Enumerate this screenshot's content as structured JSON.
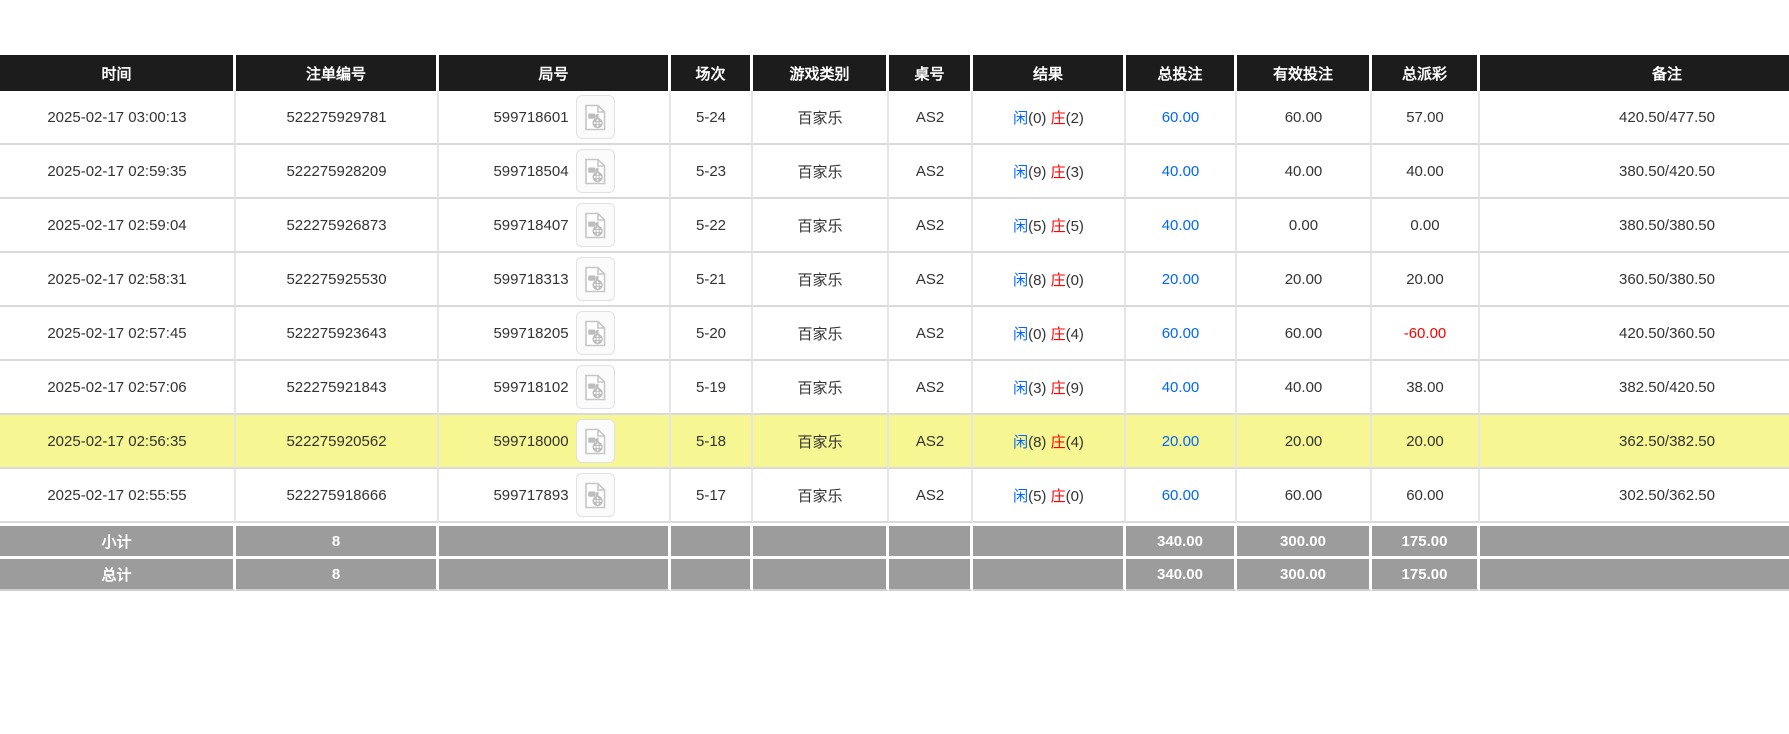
{
  "table": {
    "columns": [
      {
        "key": "time",
        "label": "时间"
      },
      {
        "key": "bet_id",
        "label": "注单编号"
      },
      {
        "key": "round",
        "label": "局号"
      },
      {
        "key": "session",
        "label": "场次"
      },
      {
        "key": "game_type",
        "label": "游戏类别"
      },
      {
        "key": "table_no",
        "label": "桌号"
      },
      {
        "key": "result",
        "label": "结果"
      },
      {
        "key": "total_bet",
        "label": "总投注"
      },
      {
        "key": "valid_bet",
        "label": "有效投注"
      },
      {
        "key": "payout",
        "label": "总派彩"
      },
      {
        "key": "remark",
        "label": "备注"
      }
    ],
    "rows": [
      {
        "time": "2025-02-17 03:00:13",
        "bet_id": "522275929781",
        "round": "599718601",
        "session": "5-24",
        "game_type": "百家乐",
        "table_no": "AS2",
        "result": {
          "player_label": "闲",
          "player": "0",
          "banker_label": "庄",
          "banker": "2"
        },
        "total_bet": "60.00",
        "valid_bet": "60.00",
        "payout": "57.00",
        "remark": "420.50/477.50",
        "highlighted": false
      },
      {
        "time": "2025-02-17 02:59:35",
        "bet_id": "522275928209",
        "round": "599718504",
        "session": "5-23",
        "game_type": "百家乐",
        "table_no": "AS2",
        "result": {
          "player_label": "闲",
          "player": "9",
          "banker_label": "庄",
          "banker": "3"
        },
        "total_bet": "40.00",
        "valid_bet": "40.00",
        "payout": "40.00",
        "remark": "380.50/420.50",
        "highlighted": false
      },
      {
        "time": "2025-02-17 02:59:04",
        "bet_id": "522275926873",
        "round": "599718407",
        "session": "5-22",
        "game_type": "百家乐",
        "table_no": "AS2",
        "result": {
          "player_label": "闲",
          "player": "5",
          "banker_label": "庄",
          "banker": "5"
        },
        "total_bet": "40.00",
        "valid_bet": "0.00",
        "payout": "0.00",
        "remark": "380.50/380.50",
        "highlighted": false
      },
      {
        "time": "2025-02-17 02:58:31",
        "bet_id": "522275925530",
        "round": "599718313",
        "session": "5-21",
        "game_type": "百家乐",
        "table_no": "AS2",
        "result": {
          "player_label": "闲",
          "player": "8",
          "banker_label": "庄",
          "banker": "0"
        },
        "total_bet": "20.00",
        "valid_bet": "20.00",
        "payout": "20.00",
        "remark": "360.50/380.50",
        "highlighted": false
      },
      {
        "time": "2025-02-17 02:57:45",
        "bet_id": "522275923643",
        "round": "599718205",
        "session": "5-20",
        "game_type": "百家乐",
        "table_no": "AS2",
        "result": {
          "player_label": "闲",
          "player": "0",
          "banker_label": "庄",
          "banker": "4"
        },
        "total_bet": "60.00",
        "valid_bet": "60.00",
        "payout": "-60.00",
        "remark": "420.50/360.50",
        "highlighted": false
      },
      {
        "time": "2025-02-17 02:57:06",
        "bet_id": "522275921843",
        "round": "599718102",
        "session": "5-19",
        "game_type": "百家乐",
        "table_no": "AS2",
        "result": {
          "player_label": "闲",
          "player": "3",
          "banker_label": "庄",
          "banker": "9"
        },
        "total_bet": "40.00",
        "valid_bet": "40.00",
        "payout": "38.00",
        "remark": "382.50/420.50",
        "highlighted": false
      },
      {
        "time": "2025-02-17 02:56:35",
        "bet_id": "522275920562",
        "round": "599718000",
        "session": "5-18",
        "game_type": "百家乐",
        "table_no": "AS2",
        "result": {
          "player_label": "闲",
          "player": "8",
          "banker_label": "庄",
          "banker": "4"
        },
        "total_bet": "20.00",
        "valid_bet": "20.00",
        "payout": "20.00",
        "remark": "362.50/382.50",
        "highlighted": true
      },
      {
        "time": "2025-02-17 02:55:55",
        "bet_id": "522275918666",
        "round": "599717893",
        "session": "5-17",
        "game_type": "百家乐",
        "table_no": "AS2",
        "result": {
          "player_label": "闲",
          "player": "5",
          "banker_label": "庄",
          "banker": "0"
        },
        "total_bet": "60.00",
        "valid_bet": "60.00",
        "payout": "60.00",
        "remark": "302.50/362.50",
        "highlighted": false
      }
    ],
    "footer": [
      {
        "label": "小计",
        "count": "8",
        "total_bet": "340.00",
        "valid_bet": "300.00",
        "payout": "175.00"
      },
      {
        "label": "总计",
        "count": "8",
        "total_bet": "340.00",
        "valid_bet": "300.00",
        "payout": "175.00"
      }
    ],
    "icons": {
      "round_video": "video-record-icon"
    },
    "colors": {
      "header_bg": "#1c1c1c",
      "footer_bg": "#9c9c9c",
      "highlight_row": "#f6f692",
      "bet_blue": "#0066ff",
      "player_blue": "#0066ff",
      "banker_red": "#ff0000",
      "negative_red": "#ff0000"
    }
  }
}
